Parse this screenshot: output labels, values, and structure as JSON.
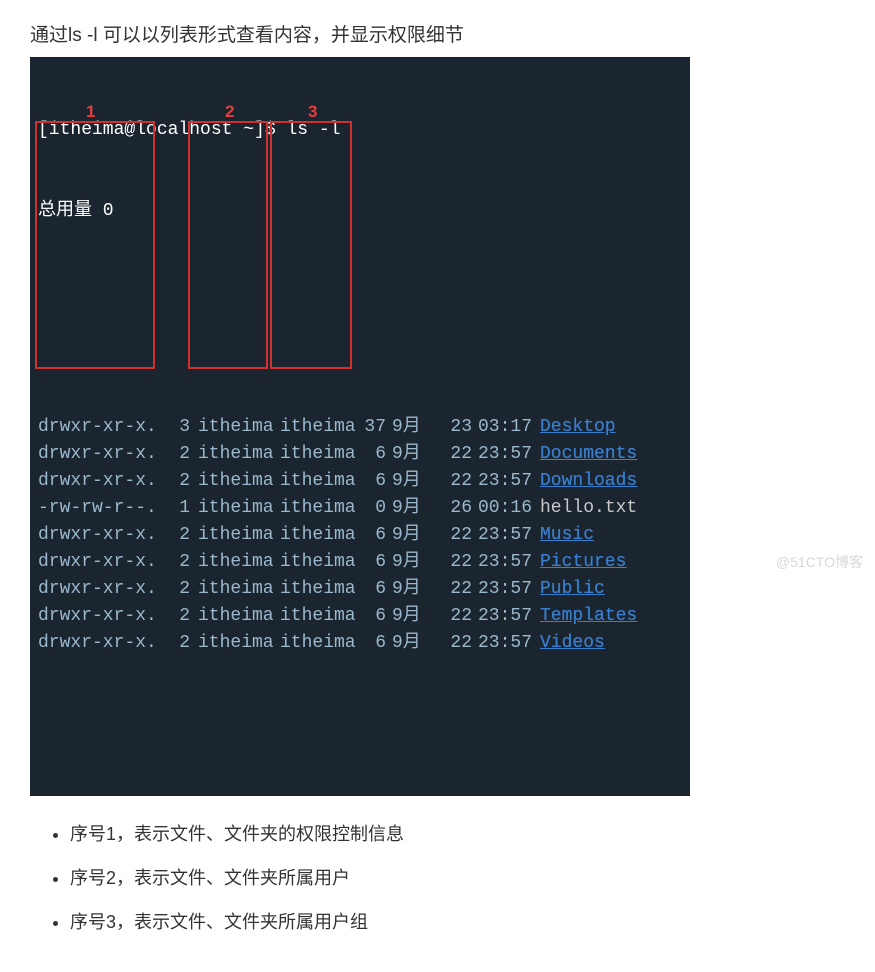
{
  "intro": "通过ls -l 可以以列表形式查看内容，并显示权限细节",
  "terminal": {
    "prompt": "[itheima@localhost ~]$ ",
    "command": "ls -l",
    "total": "总用量 0",
    "annotations": {
      "a1": "1",
      "a2": "2",
      "a3": "3"
    },
    "rows": [
      {
        "perm": "drwxr-xr-x",
        "dot": ".",
        "links": "3",
        "owner": "itheima",
        "group": "itheima",
        "size": "37",
        "month": "9月",
        "day": "23",
        "time": "03:17",
        "name": "Desktop",
        "is_dir": true
      },
      {
        "perm": "drwxr-xr-x",
        "dot": ".",
        "links": "2",
        "owner": "itheima",
        "group": "itheima",
        "size": "6",
        "month": "9月",
        "day": "22",
        "time": "23:57",
        "name": "Documents",
        "is_dir": true
      },
      {
        "perm": "drwxr-xr-x",
        "dot": ".",
        "links": "2",
        "owner": "itheima",
        "group": "itheima",
        "size": "6",
        "month": "9月",
        "day": "22",
        "time": "23:57",
        "name": "Downloads",
        "is_dir": true
      },
      {
        "perm": "-rw-rw-r--",
        "dot": ".",
        "links": "1",
        "owner": "itheima",
        "group": "itheima",
        "size": "0",
        "month": "9月",
        "day": "26",
        "time": "00:16",
        "name": "hello.txt",
        "is_dir": false
      },
      {
        "perm": "drwxr-xr-x",
        "dot": ".",
        "links": "2",
        "owner": "itheima",
        "group": "itheima",
        "size": "6",
        "month": "9月",
        "day": "22",
        "time": "23:57",
        "name": "Music",
        "is_dir": true
      },
      {
        "perm": "drwxr-xr-x",
        "dot": ".",
        "links": "2",
        "owner": "itheima",
        "group": "itheima",
        "size": "6",
        "month": "9月",
        "day": "22",
        "time": "23:57",
        "name": "Pictures",
        "is_dir": true
      },
      {
        "perm": "drwxr-xr-x",
        "dot": ".",
        "links": "2",
        "owner": "itheima",
        "group": "itheima",
        "size": "6",
        "month": "9月",
        "day": "22",
        "time": "23:57",
        "name": "Public",
        "is_dir": true
      },
      {
        "perm": "drwxr-xr-x",
        "dot": ".",
        "links": "2",
        "owner": "itheima",
        "group": "itheima",
        "size": "6",
        "month": "9月",
        "day": "22",
        "time": "23:57",
        "name": "Templates",
        "is_dir": true
      },
      {
        "perm": "drwxr-xr-x",
        "dot": ".",
        "links": "2",
        "owner": "itheima",
        "group": "itheima",
        "size": "6",
        "month": "9月",
        "day": "22",
        "time": "23:57",
        "name": "Videos",
        "is_dir": true
      }
    ]
  },
  "legend": {
    "items": [
      "序号1，表示文件、文件夹的权限控制信息",
      "序号2，表示文件、文件夹所属用户",
      "序号3，表示文件、文件夹所属用户组"
    ]
  },
  "watermark": "@51CTO博客"
}
